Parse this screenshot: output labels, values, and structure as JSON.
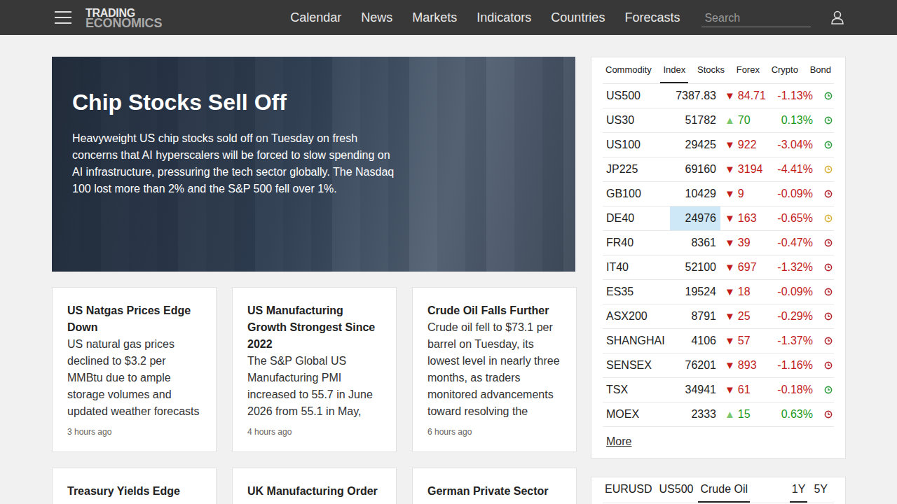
{
  "header": {
    "logo_top": "TRADING",
    "logo_bottom": "ECONOMICS",
    "nav": [
      "Calendar",
      "News",
      "Markets",
      "Indicators",
      "Countries",
      "Forecasts"
    ],
    "search": {
      "placeholder": "Search"
    }
  },
  "hero": {
    "title": "Chip Stocks Sell Off",
    "text": "Heavyweight US chip stocks sold off on Tuesday on fresh concerns that AI hyperscalers will be forced to slow spending on AI infrastructure, pressuring the tech sector globally. The Nasdaq 100 lost more than 2% and the S&P 500 fell over 1%."
  },
  "news": [
    {
      "title": "US Natgas Prices Edge Down",
      "text": "US natural gas prices declined to $3.2 per MMBtu due to ample storage volumes and updated weather forecasts",
      "time": "3 hours ago"
    },
    {
      "title": "US Manufacturing Growth Strongest Since 2022",
      "text": "The S&P Global US Manufacturing PMI increased to 55.7 in June 2026 from 55.1 in May,",
      "time": "4 hours ago"
    },
    {
      "title": "Crude Oil Falls Further",
      "text": "Crude oil fell to $73.1 per barrel on Tuesday, its lowest level in nearly three months, as traders monitored advancements toward resolving the",
      "time": "6 hours ago"
    }
  ],
  "news_more": [
    {
      "title": "Treasury Yields Edge"
    },
    {
      "title": "UK Manufacturing Order"
    },
    {
      "title": "German Private Sector"
    }
  ],
  "markets": {
    "tabs": [
      {
        "label": "Commodity",
        "selected": false
      },
      {
        "label": "Index",
        "selected": true
      },
      {
        "label": "Stocks",
        "selected": false
      },
      {
        "label": "Forex",
        "selected": false
      },
      {
        "label": "Crypto",
        "selected": false
      },
      {
        "label": "Bond",
        "selected": false
      }
    ],
    "rows": [
      {
        "name": "US500",
        "value": "7387.83",
        "arrow": "▼",
        "change": "84.71",
        "pct": "-1.13%",
        "up": false,
        "highlighted": false,
        "color": "#2e9e3e"
      },
      {
        "name": "US30",
        "value": "51782",
        "arrow": "▲",
        "change": "70",
        "pct": "0.13%",
        "up": true,
        "highlighted": false,
        "color": "#2e9e3e"
      },
      {
        "name": "US100",
        "value": "29425",
        "arrow": "▼",
        "change": "922",
        "pct": "-3.04%",
        "up": false,
        "highlighted": false,
        "color": "#2e9e3e"
      },
      {
        "name": "JP225",
        "value": "69160",
        "arrow": "▼",
        "change": "3194",
        "pct": "-4.41%",
        "up": false,
        "highlighted": false,
        "color": "#d9b23a"
      },
      {
        "name": "GB100",
        "value": "10429",
        "arrow": "▼",
        "change": "9",
        "pct": "-0.09%",
        "up": false,
        "highlighted": false,
        "color": "#b3262e"
      },
      {
        "name": "DE40",
        "value": "24976",
        "arrow": "▼",
        "change": "163",
        "pct": "-0.65%",
        "up": false,
        "highlighted": true,
        "color": "#d9b23a"
      },
      {
        "name": "FR40",
        "value": "8361",
        "arrow": "▼",
        "change": "39",
        "pct": "-0.47%",
        "up": false,
        "highlighted": false,
        "color": "#b3262e"
      },
      {
        "name": "IT40",
        "value": "52100",
        "arrow": "▼",
        "change": "697",
        "pct": "-1.32%",
        "up": false,
        "highlighted": false,
        "color": "#b3262e"
      },
      {
        "name": "ES35",
        "value": "19524",
        "arrow": "▼",
        "change": "18",
        "pct": "-0.09%",
        "up": false,
        "highlighted": false,
        "color": "#b3262e"
      },
      {
        "name": "ASX200",
        "value": "8791",
        "arrow": "▼",
        "change": "25",
        "pct": "-0.29%",
        "up": false,
        "highlighted": false,
        "color": "#b3262e"
      },
      {
        "name": "SHANGHAI",
        "value": "4106",
        "arrow": "▼",
        "change": "57",
        "pct": "-1.37%",
        "up": false,
        "highlighted": false,
        "color": "#b3262e"
      },
      {
        "name": "SENSEX",
        "value": "76201",
        "arrow": "▼",
        "change": "893",
        "pct": "-1.16%",
        "up": false,
        "highlighted": false,
        "color": "#b3262e"
      },
      {
        "name": "TSX",
        "value": "34941",
        "arrow": "▼",
        "change": "61",
        "pct": "-0.18%",
        "up": false,
        "highlighted": false,
        "color": "#2e9e3e"
      },
      {
        "name": "MOEX",
        "value": "2333",
        "arrow": "▲",
        "change": "15",
        "pct": "0.63%",
        "up": true,
        "highlighted": false,
        "color": "#b3262e"
      }
    ],
    "more": "More"
  },
  "chart_panel": {
    "tabs": [
      {
        "label": "EURUSD",
        "selected": false
      },
      {
        "label": "US500",
        "selected": false
      },
      {
        "label": "Crude Oil",
        "selected": true
      }
    ],
    "ranges": [
      {
        "label": "1Y",
        "selected": true
      },
      {
        "label": "5Y",
        "selected": false
      }
    ]
  }
}
